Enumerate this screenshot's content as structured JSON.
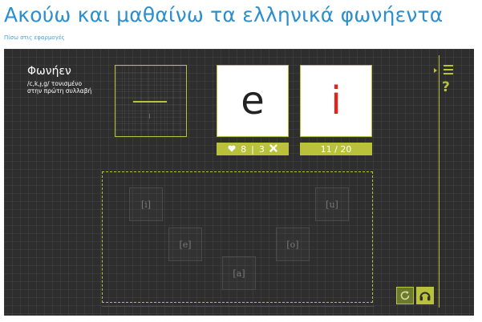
{
  "page": {
    "title": "Ακούω και μαθαίνω τα ελληνικά φωνήεντα",
    "back_link": "Πίσω στις εφαρμογές"
  },
  "lesson": {
    "title": "Φωνήεν",
    "description": "/c,k,ɟ,g/ τονισμένο στην πρώτη συλλαβή"
  },
  "cards": {
    "left_letter": "e",
    "right_letter": "i"
  },
  "score": {
    "correct": "8",
    "separator": "|",
    "wrong": "3"
  },
  "progress": {
    "label": "11 / 20"
  },
  "vowels": [
    "[i]",
    "[u]",
    "[e]",
    "[o]",
    "[a]"
  ],
  "colors": {
    "accent": "#b9c23a",
    "title_blue": "#2b8fcf",
    "dark_bg": "#2e2e2e",
    "wrong_letter": "#e2231a"
  },
  "icons": {
    "correct": "heart-icon",
    "wrong": "x-icon",
    "menu": "menu-icon",
    "help": "help-icon",
    "reload": "reload-icon",
    "listen": "headphones-icon"
  }
}
